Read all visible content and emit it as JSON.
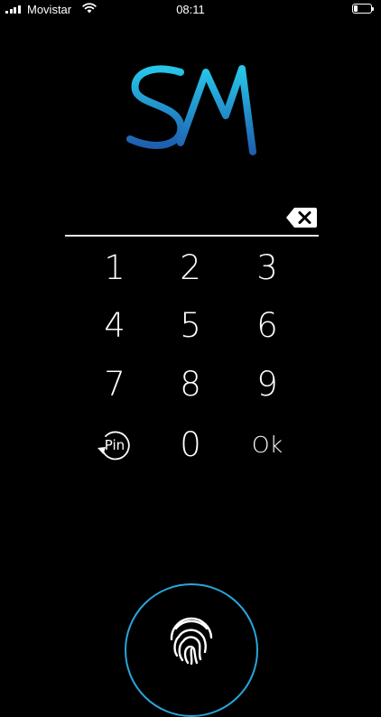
{
  "status_bar": {
    "carrier": "Movistar",
    "time": "08:11",
    "battery_level": 0.2
  },
  "logo": {
    "text": "SM"
  },
  "pin_entry": {
    "value": ""
  },
  "keypad": {
    "keys": [
      "1",
      "2",
      "3",
      "4",
      "5",
      "6",
      "7",
      "8",
      "9",
      "0"
    ],
    "pin_mode_label": "Pin",
    "ok_label": "Ok"
  },
  "colors": {
    "background": "#000000",
    "accent": "#29a5dc",
    "logo_gradient_top": "#27c6e8",
    "logo_gradient_bottom": "#1e5fb0"
  },
  "icons": {
    "backspace": "backspace-icon",
    "pin_mode": "refresh-circle-icon",
    "fingerprint": "fingerprint-icon",
    "wifi": "wifi-icon",
    "signal": "signal-icon",
    "battery": "battery-icon"
  }
}
